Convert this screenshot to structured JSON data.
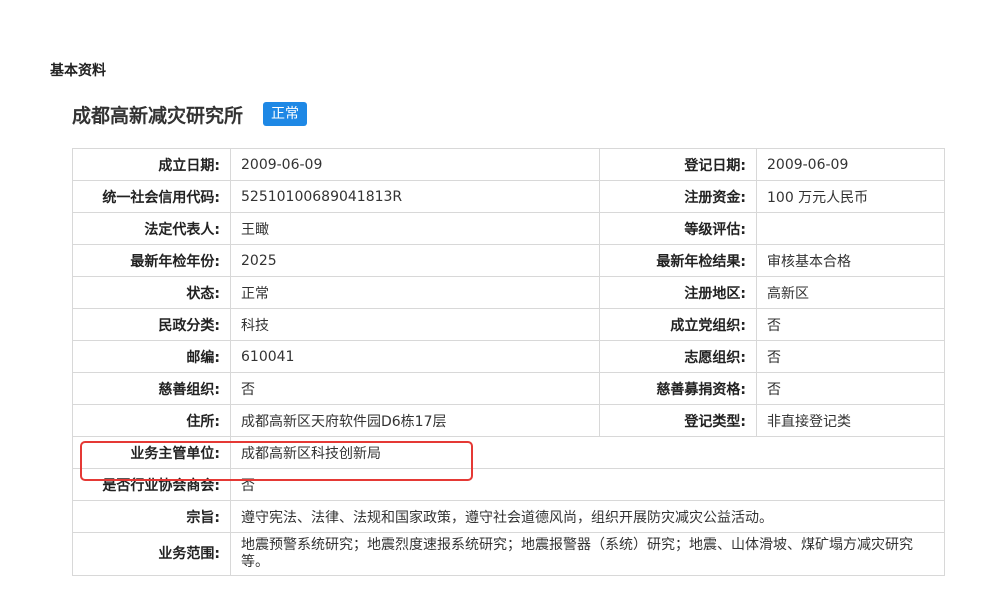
{
  "section_title": "基本资料",
  "org": {
    "name": "成都高新减灾研究所",
    "status": "正常"
  },
  "colors": {
    "badge": "#1e88e5",
    "highlight": "#e53935"
  },
  "rows": [
    {
      "l1": "成立日期:",
      "v1": "2009-06-09",
      "l2": "登记日期:",
      "v2": "2009-06-09"
    },
    {
      "l1": "统一社会信用代码:",
      "v1": "52510100689041813R",
      "l2": "注册资金:",
      "v2": "100 万元人民币"
    },
    {
      "l1": "法定代表人:",
      "v1": "王瞰",
      "l2": "等级评估:",
      "v2": ""
    },
    {
      "l1": "最新年检年份:",
      "v1": "2025",
      "l2": "最新年检结果:",
      "v2": "审核基本合格"
    },
    {
      "l1": "状态:",
      "v1": "正常",
      "l2": "注册地区:",
      "v2": "高新区"
    },
    {
      "l1": "民政分类:",
      "v1": "科技",
      "l2": "成立党组织:",
      "v2": "否"
    },
    {
      "l1": "邮编:",
      "v1": "610041",
      "l2": "志愿组织:",
      "v2": "否"
    },
    {
      "l1": "慈善组织:",
      "v1": "否",
      "l2": "慈善募捐资格:",
      "v2": "否"
    },
    {
      "l1": "住所:",
      "v1": "成都高新区天府软件园D6栋17层",
      "l2": "登记类型:",
      "v2": "非直接登记类"
    }
  ],
  "full_rows": [
    {
      "label": "业务主管单位:",
      "value": "成都高新区科技创新局"
    },
    {
      "label": "是否行业协会商会:",
      "value": "否"
    },
    {
      "label": "宗旨:",
      "value": "遵守宪法、法律、法规和国家政策，遵守社会道德风尚，组织开展防灾减灾公益活动。"
    },
    {
      "label": "业务范围:",
      "value": "地震预警系统研究；地震烈度速报系统研究；地震报警器（系统）研究；地震、山体滑坡、煤矿塌方减灾研究等。"
    }
  ]
}
